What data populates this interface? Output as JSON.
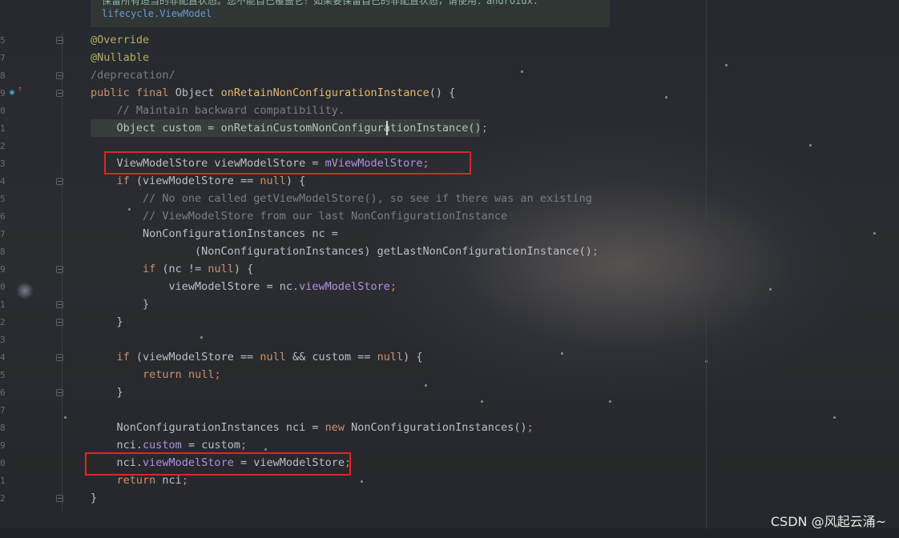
{
  "doc_popup": {
    "line1": "保留所有适当的非配置状态。您不能自己覆盖它！如果要保留自己的非配置状态，请使用：androidx.",
    "line2": "lifecycle.ViewModel"
  },
  "gutter": {
    "line_numbers": [
      "5",
      "7",
      "8",
      "9",
      "0",
      "1",
      "2",
      "3",
      "4",
      "5",
      "6",
      "7",
      "8",
      "9",
      "0",
      "1",
      "2",
      "3",
      "4",
      "5",
      "6",
      "7",
      "8",
      "9",
      "0",
      "1",
      "2"
    ]
  },
  "code": {
    "l1": "@Override",
    "l2": "@Nullable",
    "l3": "/deprecation/",
    "l4_kw1": "public",
    "l4_kw2": "final",
    "l4_type": "Object",
    "l4_fn": "onRetainNonConfigurationInstance",
    "l4_rest": "() {",
    "l5": "// Maintain backward compatibility.",
    "l6_a": "Object custom = ",
    "l6_fn": "onRetainCustomNonConfigurationInstance",
    "l6_b": "()",
    "l6_semi": ";",
    "l8_a": "ViewModelStore viewModelStore = ",
    "l8_fld": "mViewModelStore",
    "l8_semi": ";",
    "l9_kw": "if",
    "l9_a": " (viewModelStore == ",
    "l9_null": "null",
    "l9_b": ") {",
    "l10": "// No one called getViewModelStore(), so see if there was an existing",
    "l11": "// ViewModelStore from our last NonConfigurationInstance",
    "l12": "NonConfigurationInstances nc =",
    "l13_a": "(NonConfigurationInstances) getLastNonConfigurationInstance()",
    "l13_semi": ";",
    "l14_kw": "if",
    "l14_a": " (nc != ",
    "l14_null": "null",
    "l14_b": ") {",
    "l15_a": "viewModelStore = nc.",
    "l15_fld": "viewModelStore",
    "l15_semi": ";",
    "l16": "}",
    "l17": "}",
    "l19_kw": "if",
    "l19_a": " (viewModelStore == ",
    "l19_null1": "null",
    "l19_b": " && custom == ",
    "l19_null2": "null",
    "l19_c": ") {",
    "l20_kw": "return",
    "l20_null": "null",
    "l20_semi": ";",
    "l21": "}",
    "l23_a": "NonConfigurationInstances nci = ",
    "l23_kw": "new",
    "l23_b": " NonConfigurationInstances()",
    "l23_semi": ";",
    "l24_a": "nci.",
    "l24_fld": "custom",
    "l24_b": " = custom",
    "l24_semi": ";",
    "l25_a": "nci.",
    "l25_fld": "viewModelStore",
    "l25_b": " = viewModelStore",
    "l25_semi": ";",
    "l26_kw": "return",
    "l26_a": " nci",
    "l26_semi": ";",
    "l27": "}"
  },
  "watermark": "CSDN @风起云涌~",
  "colors": {
    "keyword": "#cf8e6d",
    "annotation": "#b3ae60",
    "method": "#e8b86b",
    "field": "#b48ee0",
    "comment": "#7a7e85",
    "highlight_box": "#e0232b"
  }
}
